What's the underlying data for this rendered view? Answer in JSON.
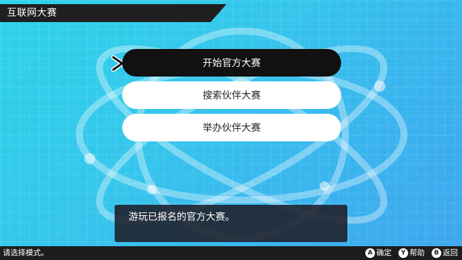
{
  "header": {
    "title": "互联网大赛"
  },
  "menu": {
    "items": [
      {
        "label": "开始官方大赛",
        "selected": true
      },
      {
        "label": "搜索伙伴大赛",
        "selected": false
      },
      {
        "label": "举办伙伴大赛",
        "selected": false
      }
    ]
  },
  "message": {
    "text": "游玩已报名的官方大赛。"
  },
  "footer": {
    "hint": "请选择模式。",
    "controls": [
      {
        "button": "A",
        "label": "确定"
      },
      {
        "button": "Y",
        "label": "帮助"
      },
      {
        "button": "B",
        "label": "返回"
      }
    ]
  },
  "colors": {
    "background": "#35c6ec",
    "selected_item": "#111111",
    "item": "#ffffff",
    "bars": "#1d1d1d"
  },
  "icons": {
    "cursor": "chevron-right-icon"
  }
}
